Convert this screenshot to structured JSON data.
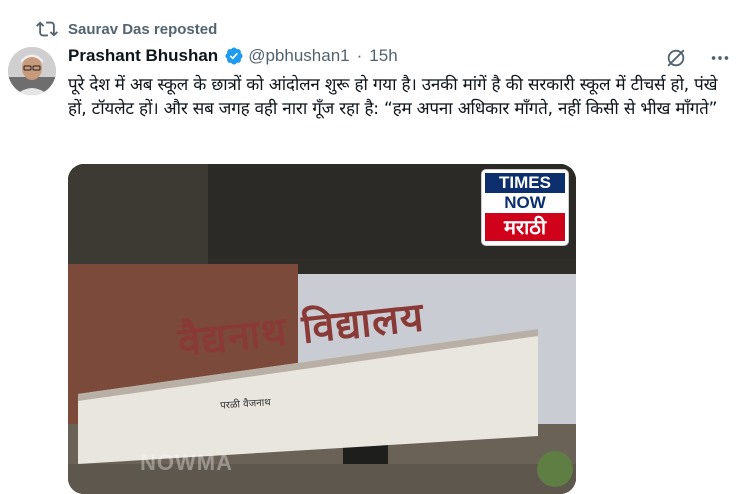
{
  "repost": {
    "text": "Saurav Das reposted",
    "icon": "repost-icon"
  },
  "author": {
    "name": "Prashant Bhushan",
    "handle": "@pbhushan1",
    "separator": "·",
    "time": "15h",
    "verified_color": "#1d9bf0"
  },
  "actions": {
    "grok_icon": "grok-icon",
    "more_icon": "more-icon"
  },
  "tweet": {
    "text": "पूरे देश में अब स्कूल के छात्रों को आंदोलन शुरू हो गया है। उनकी मांगें है की सरकारी स्कूल में टीचर्स हो, पंखे हों, टॉयलेट हों। और सब जगह वही नारा गूँज रहा है: “हम अपना अधिकार माँगते, नहीं किसी से भीख माँगते”"
  },
  "media": {
    "logo": {
      "line1": "TIMES",
      "line2": "NOW",
      "line3": "मराठी"
    },
    "board_text": "वैद्यनाथ विद्यालय",
    "board_subtext": "परळी वैजनाथ",
    "watermark": "NOWMA"
  },
  "colors": {
    "muted": "#536471",
    "text": "#0f1419",
    "accent": "#1d9bf0"
  }
}
